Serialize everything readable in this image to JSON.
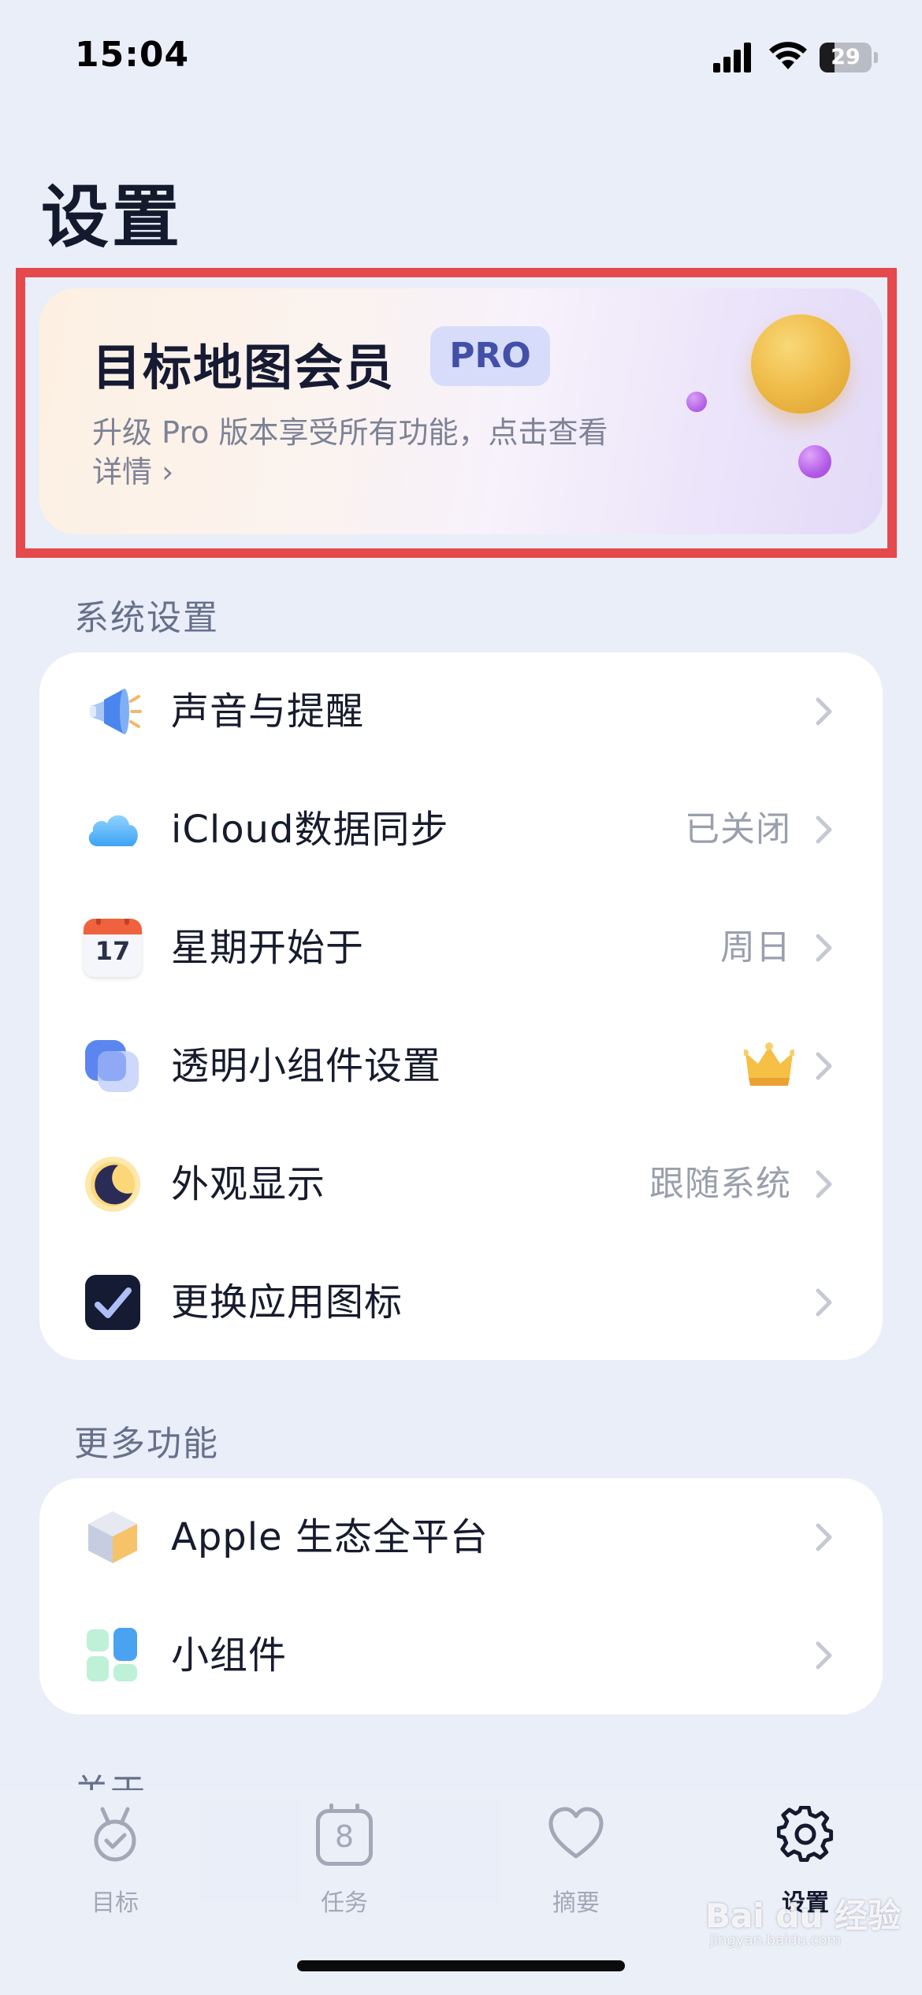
{
  "status_bar": {
    "time": "15:04",
    "battery": "29",
    "battery_level_percent": 29
  },
  "page_title": "设置",
  "promo": {
    "title": "目标地图会员",
    "badge": "PRO",
    "description_line1": "升级 Pro 版本享受所有功能，点击查看",
    "description_line2": "详情 ›"
  },
  "sections": {
    "system": {
      "label": "系统设置",
      "items": [
        {
          "label": "声音与提醒",
          "value": "",
          "icon": "megaphone-icon"
        },
        {
          "label": "iCloud数据同步",
          "value": "已关闭",
          "icon": "cloud-icon"
        },
        {
          "label": "星期开始于",
          "value": "周日",
          "icon": "calendar-icon",
          "icon_text": "17"
        },
        {
          "label": "透明小组件设置",
          "value": "",
          "icon": "widget-layers-icon",
          "badge_icon": "crown-icon"
        },
        {
          "label": "外观显示",
          "value": "跟随系统",
          "icon": "moon-icon"
        },
        {
          "label": "更换应用图标",
          "value": "",
          "icon": "checkbox-app-icon"
        }
      ]
    },
    "more": {
      "label": "更多功能",
      "items": [
        {
          "label": "Apple 生态全平台",
          "value": "",
          "icon": "cube-icon"
        },
        {
          "label": "小组件",
          "value": "",
          "icon": "widgets-grid-icon"
        }
      ]
    },
    "about": {
      "label": "关于"
    }
  },
  "tab_bar": {
    "tabs": [
      {
        "label": "目标",
        "icon": "medal-icon",
        "active": false
      },
      {
        "label": "任务",
        "icon": "calendar-day-icon",
        "icon_text": "8",
        "active": false
      },
      {
        "label": "摘要",
        "icon": "heart-icon",
        "active": false
      },
      {
        "label": "设置",
        "icon": "gear-icon",
        "active": true
      }
    ]
  },
  "watermark": {
    "brand": "Bai du 经验",
    "url": "jingyan.baidu.com"
  },
  "colors": {
    "background": "#eaeef8",
    "card": "#ffffff",
    "highlight_border": "#e5484d",
    "pro_badge_bg": "#d6dcfa",
    "pro_badge_text": "#4350a8",
    "active_tab": "#141a2e",
    "inactive_tab": "#a3a8b8"
  }
}
